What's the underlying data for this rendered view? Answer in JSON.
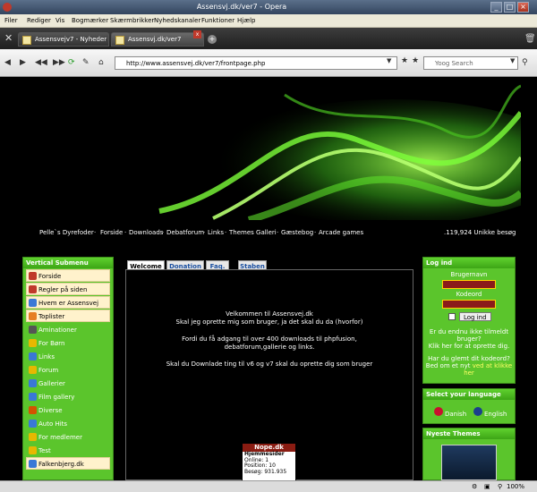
{
  "window": {
    "title": "Assensvj.dk/ver7 - Opera"
  },
  "menu": [
    "Filer",
    "Rediger",
    "Vis",
    "Bogmærker",
    "Skærmbrikker",
    "Nyhedskanaler",
    "Funktioner",
    "Hjælp"
  ],
  "tabs": [
    {
      "label": "Assensvejv7 - Nyheder"
    },
    {
      "label": "Assensvj.dk/ver7"
    }
  ],
  "address": {
    "url": "http://www.assensvej.dk/ver7/frontpage.php",
    "search_placeholder": "Yoog Search"
  },
  "topnav": {
    "links": [
      "Pelle`s Dyrefoder",
      "Forside",
      "Downloads",
      "Debatforum",
      "Links",
      "Themes Galleri",
      "Gæstebog",
      "Arcade games"
    ],
    "visitors": ".119,924 Unikke besøg"
  },
  "leftmenu": {
    "title": "Vertical Submenu",
    "items": [
      {
        "label": "Forside",
        "color": "#c0392b",
        "style": "light"
      },
      {
        "label": "Regler på siden",
        "color": "#c0392b",
        "style": "light"
      },
      {
        "label": "Hvem er Assensvej",
        "color": "#3a78d6",
        "style": "light"
      },
      {
        "label": "Toplister",
        "color": "#e67e22",
        "style": "light"
      },
      {
        "label": "Aminationer",
        "color": "#555555",
        "style": "green"
      },
      {
        "label": "For Børn",
        "color": "#e6b800",
        "style": "green"
      },
      {
        "label": "Links",
        "color": "#3a78d6",
        "style": "green"
      },
      {
        "label": "Forum",
        "color": "#e6b800",
        "style": "green"
      },
      {
        "label": "Gallerier",
        "color": "#3a78d6",
        "style": "green"
      },
      {
        "label": "Film gallery",
        "color": "#3a78d6",
        "style": "green"
      },
      {
        "label": "Diverse",
        "color": "#d35400",
        "style": "green"
      },
      {
        "label": "Auto Hits",
        "color": "#3a78d6",
        "style": "green"
      },
      {
        "label": "For medlemer",
        "color": "#e6b800",
        "style": "green"
      },
      {
        "label": "Test",
        "color": "#e6b800",
        "style": "green"
      },
      {
        "label": "Falkenbjerg.dk",
        "color": "#3a78d6",
        "style": "light"
      }
    ]
  },
  "center": {
    "tabs": [
      "Welcome",
      "Donation",
      "Faq.",
      "Staben"
    ],
    "lines": [
      "Velkommen til Assensvej.dk",
      "Skal jeg oprette mig som bruger, ja det skal du da (hvorfor)",
      "Fordi du få adgang til over 400 downloads til phpfusion,",
      "debatforum,gallerie og links.",
      "Skal du Downlade ting til v6 og v7 skal du oprette dig som bruger"
    ],
    "nope": {
      "title": "Nope.dk",
      "rows": [
        "Hjemmesider",
        "Online:   1",
        "Position:  10",
        "Besøg:    931.935"
      ]
    }
  },
  "login": {
    "title": "Log ind",
    "username_label": "Brugernavn",
    "password_label": "Kodeord",
    "button": "Log ind",
    "register_text": "Er du endnu ikke tilmeldt bruger?",
    "register_link": "Klik her",
    "register_suffix": "for at oprette dig.",
    "forgot_text": "Har du glemt dit kodeord?",
    "forgot_prefix": "Bed om et nyt",
    "forgot_link": "ved at klikke her"
  },
  "language": {
    "title": "Select your language",
    "danish": "Danish",
    "english": "English"
  },
  "themes": {
    "title": "Nyeste Themes"
  },
  "status": {
    "zoom": "100%"
  }
}
